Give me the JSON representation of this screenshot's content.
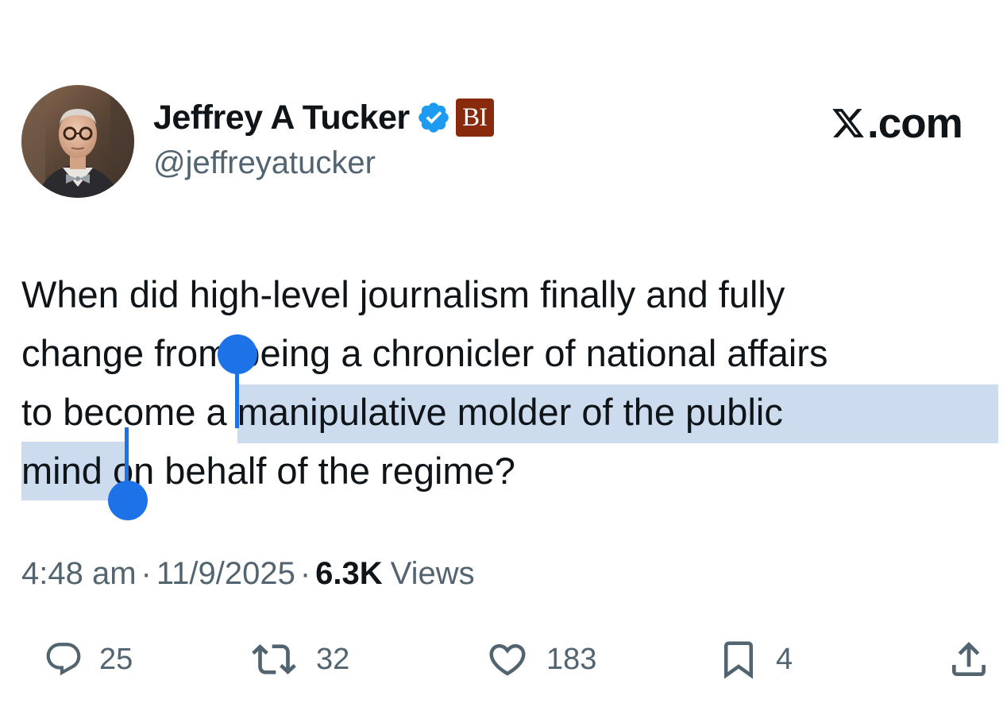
{
  "author": {
    "display_name": "Jeffrey A Tucker",
    "handle": "@jeffreyatucker",
    "affiliate_badge": "BI",
    "verified_icon": "verified-badge-icon",
    "avatar": "profile-photo"
  },
  "brand": {
    "text": ".com",
    "icon": "x-logo-icon"
  },
  "tweet": {
    "lines": [
      {
        "before": "",
        "selected": "",
        "after": "When did high-level journalism finally and fully"
      },
      {
        "before": "change from being a chronicler of national affairs",
        "selected": "",
        "after": ""
      },
      {
        "before": "to become ",
        "selected": "a manipulative molder of the public",
        "after": ""
      },
      {
        "before": "",
        "selected": "mind ",
        "after": "on behalf of the regime?"
      }
    ]
  },
  "meta": {
    "time": "4:48 am",
    "separator": "·",
    "date": "11/9/2025",
    "views_count": "6.3K",
    "views_label": "Views"
  },
  "actions": {
    "replies": "25",
    "reposts": "32",
    "likes": "183",
    "bookmarks": "4"
  },
  "colors": {
    "text_primary": "#0f1419",
    "text_secondary": "#536471",
    "verified_blue": "#1d9bf0",
    "selection_highlight": "#ccdcee",
    "selection_handle": "#1d72e8",
    "affiliate_badge_bg": "#8a2a0c"
  }
}
